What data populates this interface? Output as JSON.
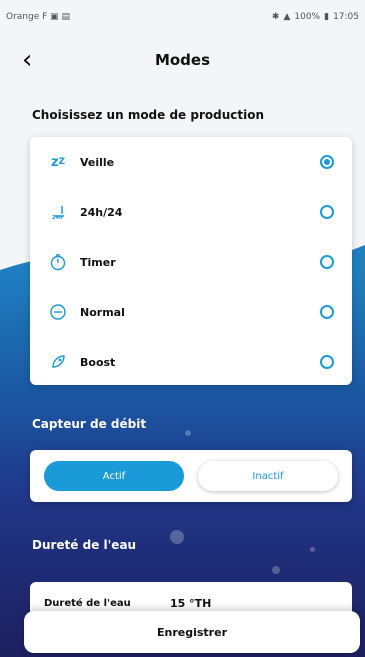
{
  "status_bar": {
    "carrier": "Orange F",
    "right_text": "100%",
    "time": "17:05"
  },
  "header": {
    "title": "Modes"
  },
  "production": {
    "heading": "Choisissez un mode de production",
    "modes": [
      {
        "label": "Veille",
        "icon": "sleep-icon",
        "selected": true
      },
      {
        "label": "24h/24",
        "icon": "clock-24-icon",
        "selected": false
      },
      {
        "label": "Timer",
        "icon": "stopwatch-icon",
        "selected": false
      },
      {
        "label": "Normal",
        "icon": "minus-circle-icon",
        "selected": false
      },
      {
        "label": "Boost",
        "icon": "rocket-icon",
        "selected": false
      }
    ]
  },
  "flow_sensor": {
    "heading": "Capteur de débit",
    "active_label": "Actif",
    "inactive_label": "Inactif"
  },
  "water_hardness": {
    "heading": "Dureté de l'eau",
    "field_label": "Dureté de l'eau",
    "value": "15 °TH"
  },
  "footer": {
    "save_label": "Enregistrer"
  },
  "colors": {
    "accent": "#1a9ad6",
    "wave_top": "#1f7fc0",
    "wave_bottom": "#1d1f5e"
  }
}
